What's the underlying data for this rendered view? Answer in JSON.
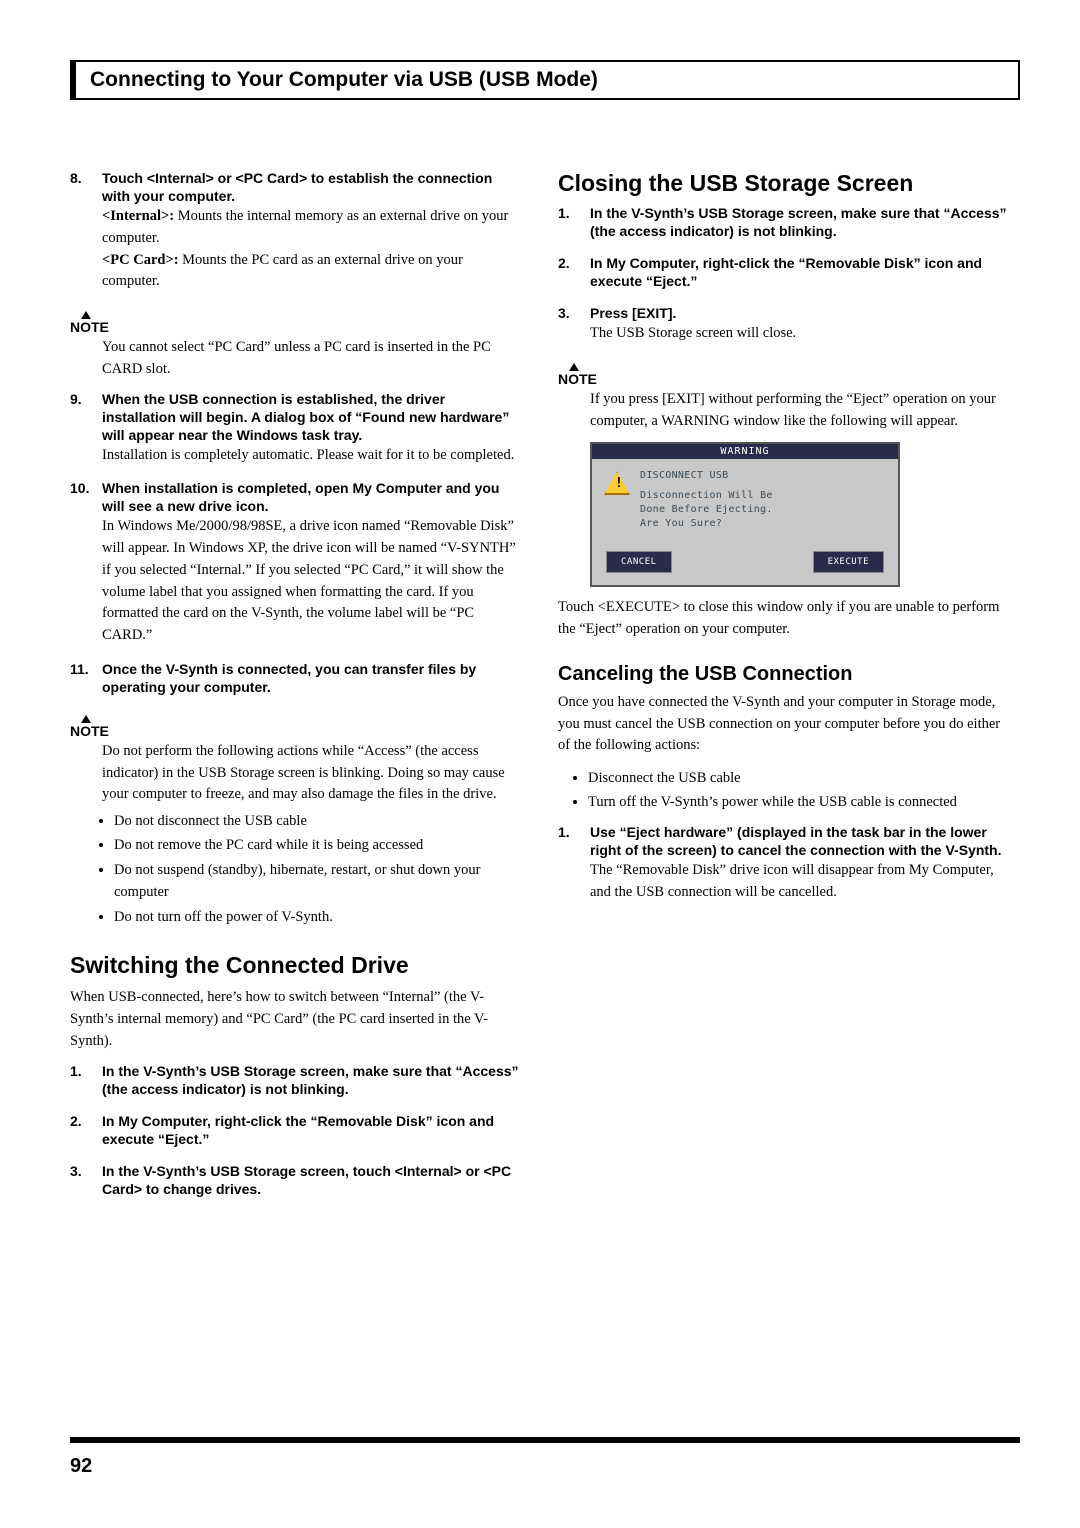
{
  "header": "Connecting to Your Computer via USB (USB Mode)",
  "left": {
    "step8": {
      "num": "8.",
      "bold": "Touch <Internal> or <PC Card> to establish the connection with your computer.",
      "line1_b": "<Internal>:",
      "line1": " Mounts the internal memory as an external drive on your computer.",
      "line2_b": "<PC Card>:",
      "line2": " Mounts the PC card as an external drive on your computer."
    },
    "note1_label": "NOTE",
    "note1": "You cannot select “PC Card” unless a PC card is inserted in the PC CARD slot.",
    "step9": {
      "num": "9.",
      "bold": "When the USB connection is established, the driver installation will begin. A dialog box of “Found new hardware” will appear near the Windows task tray.",
      "body": "Installation is completely automatic. Please wait for it to be completed."
    },
    "step10": {
      "num": "10.",
      "bold": "When installation is completed, open My Computer and you will see a new drive icon.",
      "body": "In Windows Me/2000/98/98SE, a drive icon named “Removable Disk” will appear. In Windows XP, the drive icon will be named “V-SYNTH” if you selected “Internal.” If you selected “PC Card,” it will show the volume label that you assigned when formatting the card. If you formatted the card on the V-Synth, the volume label will be “PC CARD.”"
    },
    "step11": {
      "num": "11.",
      "bold": "Once the V-Synth is connected, you can transfer files by operating your computer."
    },
    "note2_label": "NOTE",
    "note2": "Do not perform the following actions while “Access” (the access indicator) in the USB Storage screen is blinking. Doing so may cause your computer to freeze, and may also damage the files in the drive.",
    "bullets": [
      "Do not disconnect the USB cable",
      "Do not remove the PC card while it is being accessed",
      "Do not suspend (standby), hibernate, restart, or shut down your computer",
      "Do not turn off the power of V-Synth."
    ],
    "h2": "Switching the Connected Drive",
    "h2_intro": "When USB-connected, here’s how to switch between “Internal” (the V-Synth’s internal memory) and “PC Card” (the PC card inserted in the V-Synth).",
    "s1": {
      "num": "1.",
      "bold": "In the V-Synth’s USB Storage screen, make sure that “Access” (the access indicator) is not blinking."
    },
    "s2": {
      "num": "2.",
      "bold": "In My Computer, right-click the “Removable Disk” icon and execute “Eject.”"
    },
    "s3": {
      "num": "3.",
      "bold": "In the V-Synth’s USB Storage screen, touch <Internal> or <PC Card> to change drives."
    }
  },
  "right": {
    "h2a": "Closing the USB Storage Screen",
    "c1": {
      "num": "1.",
      "bold": "In the V-Synth’s USB Storage screen, make sure that “Access” (the access indicator) is not blinking."
    },
    "c2": {
      "num": "2.",
      "bold": "In My Computer, right-click the “Removable Disk” icon and execute “Eject.”"
    },
    "c3": {
      "num": "3.",
      "bold": "Press [EXIT].",
      "body": "The USB Storage screen will close."
    },
    "note_label": "NOTE",
    "note": "If you press [EXIT] without performing the “Eject” operation on your computer, a WARNING window like the following will appear.",
    "warn": {
      "title": "WARNING",
      "l1": "DISCONNECT USB",
      "l2": "Disconnection Will Be",
      "l3": "Done Before Ejecting.",
      "l4": "Are You Sure?",
      "cancel": "CANCEL",
      "execute": "EXECUTE"
    },
    "after_warn": "Touch <EXECUTE> to close this window only if you are unable to perform the “Eject” operation on your computer.",
    "h2b": "Canceling the USB Connection",
    "h2b_intro": "Once you have connected the V-Synth and your computer in Storage mode, you must cancel the USB connection on your computer before you do either of the following actions:",
    "bullets": [
      "Disconnect the USB cable",
      "Turn off the V-Synth’s power while the USB cable is connected"
    ],
    "u1": {
      "num": "1.",
      "bold": "Use “Eject hardware” (displayed in the task bar in the lower right of the screen) to cancel the connection with the V-Synth.",
      "body": "The “Removable Disk” drive icon will disappear from My Computer, and the USB connection will be cancelled."
    }
  },
  "page_number": "92"
}
